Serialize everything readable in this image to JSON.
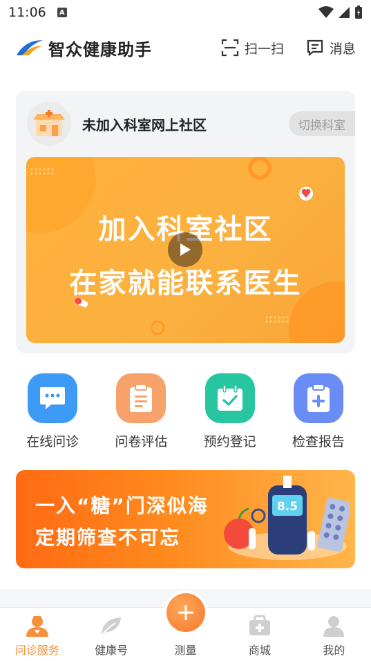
{
  "status_bar": {
    "time": "11:06",
    "notice_badge": "A"
  },
  "header": {
    "app_title": "智众健康助手",
    "scan_label": "扫一扫",
    "message_label": "消息"
  },
  "community": {
    "title": "未加入科室网上社区",
    "switch_label": "切换科室",
    "banner": {
      "line1": "加入科室社区",
      "line2": "在家就能联系医生"
    }
  },
  "services": [
    {
      "label": "在线问诊",
      "icon": "chat-icon",
      "color": "#3d9bf5"
    },
    {
      "label": "问卷评估",
      "icon": "clipboard-icon",
      "color": "#f8a26b"
    },
    {
      "label": "预约登记",
      "icon": "calendar-check-icon",
      "color": "#27c6a0"
    },
    {
      "label": "检查报告",
      "icon": "report-plus-icon",
      "color": "#6a8df5"
    }
  ],
  "promo": {
    "line1": "一入“糖”门深似海",
    "line2": "定期筛查不可忘",
    "meter_reading": "8.5"
  },
  "bottom_nav": [
    {
      "label": "问诊服务",
      "icon": "doctor-icon",
      "active": true
    },
    {
      "label": "健康号",
      "icon": "leaf-icon",
      "active": false
    },
    {
      "label": "测量",
      "icon": "plus-icon",
      "active": false
    },
    {
      "label": "商城",
      "icon": "medicine-box-icon",
      "active": false
    },
    {
      "label": "我的",
      "icon": "user-icon",
      "active": false
    }
  ],
  "colors": {
    "accent": "#f7913a",
    "banner": "#fbb03f",
    "promo": "#ff7a1a"
  }
}
